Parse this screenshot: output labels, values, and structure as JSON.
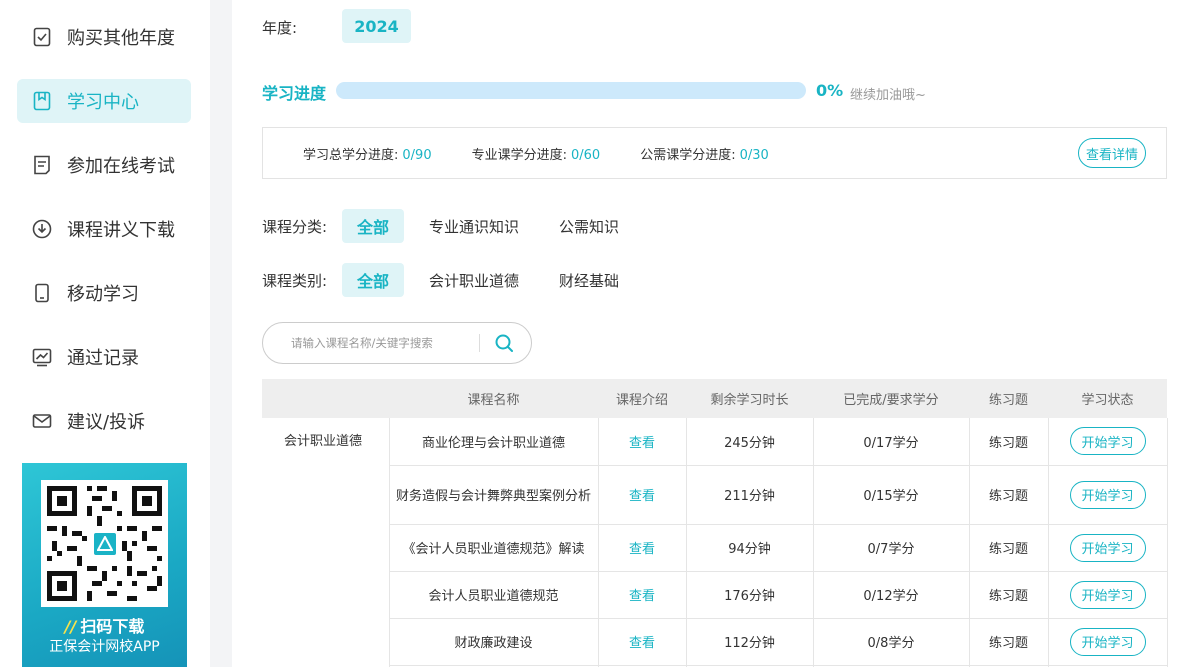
{
  "sidebar": {
    "items": [
      {
        "label": "购买其他年度",
        "icon": "checkbox-icon",
        "active": false
      },
      {
        "label": "学习中心",
        "icon": "bookmark-icon",
        "active": true
      },
      {
        "label": "参加在线考试",
        "icon": "exam-icon",
        "active": false
      },
      {
        "label": "课程讲义下载",
        "icon": "download-icon",
        "active": false
      },
      {
        "label": "移动学习",
        "icon": "mobile-icon",
        "active": false
      },
      {
        "label": "通过记录",
        "icon": "chart-icon",
        "active": false
      },
      {
        "label": "建议/投诉",
        "icon": "mail-icon",
        "active": false
      }
    ],
    "qr": {
      "cta": "扫码下载",
      "subtitle": "正保会计网校APP"
    }
  },
  "year": {
    "label": "年度:",
    "value": "2024"
  },
  "progress": {
    "title": "学习进度",
    "percent_text": "0%",
    "percent": 0,
    "message": "继续加油哦~"
  },
  "credits": {
    "items": [
      {
        "label": "学习总学分进度:",
        "value": "0/90"
      },
      {
        "label": "专业课学分进度:",
        "value": "0/60"
      },
      {
        "label": "公需课学分进度:",
        "value": "0/30"
      }
    ],
    "detail_button": "查看详情"
  },
  "filters": {
    "classification": {
      "label": "课程分类:",
      "options": [
        "全部",
        "专业通识知识",
        "公需知识"
      ],
      "selected": "全部"
    },
    "category": {
      "label": "课程类别:",
      "options": [
        "全部",
        "会计职业道德",
        "财经基础"
      ],
      "selected": "全部"
    }
  },
  "search": {
    "placeholder": "请输入课程名称/关键字搜索"
  },
  "table": {
    "headers": [
      "",
      "课程名称",
      "课程介绍",
      "剩余学习时长",
      "已完成/要求学分",
      "练习题",
      "学习状态"
    ],
    "category": "会计职业道德",
    "rows": [
      {
        "name": "商业伦理与会计职业道德",
        "intro": "查看",
        "remaining": "245分钟",
        "credits": "0/17学分",
        "exercise": "练习题",
        "status": "开始学习"
      },
      {
        "name": "财务造假与会计舞弊典型案例分析",
        "intro": "查看",
        "remaining": "211分钟",
        "credits": "0/15学分",
        "exercise": "练习题",
        "status": "开始学习"
      },
      {
        "name": "《会计人员职业道德规范》解读",
        "intro": "查看",
        "remaining": "94分钟",
        "credits": "0/7学分",
        "exercise": "练习题",
        "status": "开始学习"
      },
      {
        "name": "会计人员职业道德规范",
        "intro": "查看",
        "remaining": "176分钟",
        "credits": "0/12学分",
        "exercise": "练习题",
        "status": "开始学习"
      },
      {
        "name": "财政廉政建设",
        "intro": "查看",
        "remaining": "112分钟",
        "credits": "0/8学分",
        "exercise": "练习题",
        "status": "开始学习"
      }
    ]
  },
  "colors": {
    "accent": "#19b4c4",
    "accent_bg": "#dff4f7",
    "track": "#cde9fb"
  }
}
